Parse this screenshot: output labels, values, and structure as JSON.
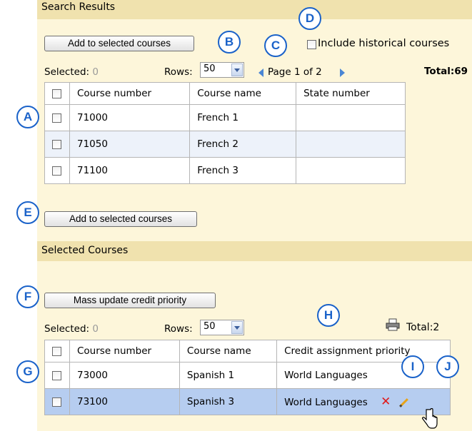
{
  "search_results": {
    "section_title": "Search Results",
    "add_button": "Add to selected courses",
    "include_historical": "Include historical courses",
    "selected_label": "Selected:",
    "selected_count": "0",
    "rows_label": "Rows:",
    "rows_value": "50",
    "pager_text": "Page 1 of 2",
    "total": "Total:69",
    "columns": [
      "Course number",
      "Course name",
      "State number"
    ],
    "rows": [
      {
        "number": "71000",
        "name": "French 1",
        "state": ""
      },
      {
        "number": "71050",
        "name": "French 2",
        "state": ""
      },
      {
        "number": "71100",
        "name": "French 3",
        "state": ""
      }
    ],
    "add_button_bottom": "Add to selected courses"
  },
  "selected_courses": {
    "section_title": "Selected Courses",
    "mass_update_button": "Mass update credit priority",
    "selected_label": "Selected:",
    "selected_count": "0",
    "rows_label": "Rows:",
    "rows_value": "50",
    "total": "Total:2",
    "columns": [
      "Course number",
      "Course name",
      "Credit assignment priority"
    ],
    "rows": [
      {
        "number": "73000",
        "name": "Spanish 1",
        "priority": "World Languages"
      },
      {
        "number": "73100",
        "name": "Spanish 3",
        "priority": "World Languages"
      }
    ]
  },
  "callouts": [
    "A",
    "B",
    "C",
    "D",
    "E",
    "F",
    "G",
    "H",
    "I",
    "J"
  ],
  "colors": {
    "callout": "#1a62c9",
    "section_bar": "#f0e2ae",
    "panel": "#fdf6da",
    "highlight_row": "#b6cdf0",
    "delete": "#e01b1b"
  },
  "icons": [
    "checkbox-icon",
    "prev-page-icon",
    "next-page-icon",
    "printer-icon",
    "delete-icon",
    "edit-pencil-icon",
    "hand-cursor-icon"
  ]
}
